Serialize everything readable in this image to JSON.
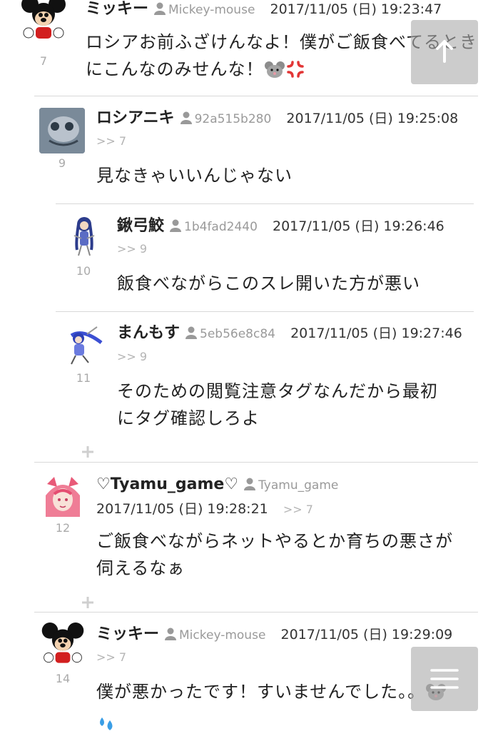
{
  "comments": [
    {
      "number": "7",
      "name": "ミッキー",
      "user_id": "Mickey-mouse",
      "timestamp": "2017/11/05 (日) 19:23:47",
      "reply_to": "",
      "body": "ロシアお前ふざけんなよ！僕がご飯食べてるときにこんなのみせんな！",
      "emojis": [
        "mouse-emoji",
        "anger-emoji"
      ]
    },
    {
      "number": "9",
      "name": "ロシアニキ",
      "user_id": "92a515b280",
      "timestamp": "2017/11/05 (日) 19:25:08",
      "reply_to": ">> 7",
      "body": "見なきゃいいんじゃない"
    },
    {
      "number": "10",
      "name": "鍬弓鮫",
      "user_id": "1b4fad2440",
      "timestamp": "2017/11/05 (日) 19:26:46",
      "reply_to": ">> 9",
      "body": "飯食べながらこのスレ開いた方が悪い"
    },
    {
      "number": "11",
      "name": "まんもす",
      "user_id": "5eb56e8c84",
      "timestamp": "2017/11/05 (日) 19:27:46",
      "reply_to": ">> 9",
      "body_lines": [
        "そのための閲覧注意タグなんだから最初",
        "にタグ確認しろよ"
      ]
    },
    {
      "number": "12",
      "name": "♡Tyamu_game♡",
      "user_id": "Tyamu_game",
      "timestamp": "2017/11/05 (日) 19:28:21",
      "reply_to": ">> 7",
      "body_lines": [
        "ご飯食べながらネットやるとか育ちの悪さが",
        "伺えるなぁ"
      ]
    },
    {
      "number": "14",
      "name": "ミッキー",
      "user_id": "Mickey-mouse",
      "timestamp": "2017/11/05 (日) 19:29:09",
      "reply_to": ">> 7",
      "body": "僕が悪かったです！すいませんでした。。",
      "emojis": [
        "mouse-emoji",
        "sweat-drops-emoji"
      ]
    }
  ],
  "buttons": {
    "scroll_top": "arrow-up-icon",
    "menu": "menu-icon"
  },
  "colors": {
    "text": "#222222",
    "meta": "#9a9a9a",
    "separator": "#d8d8d8",
    "fab": "#aaaaaa"
  }
}
